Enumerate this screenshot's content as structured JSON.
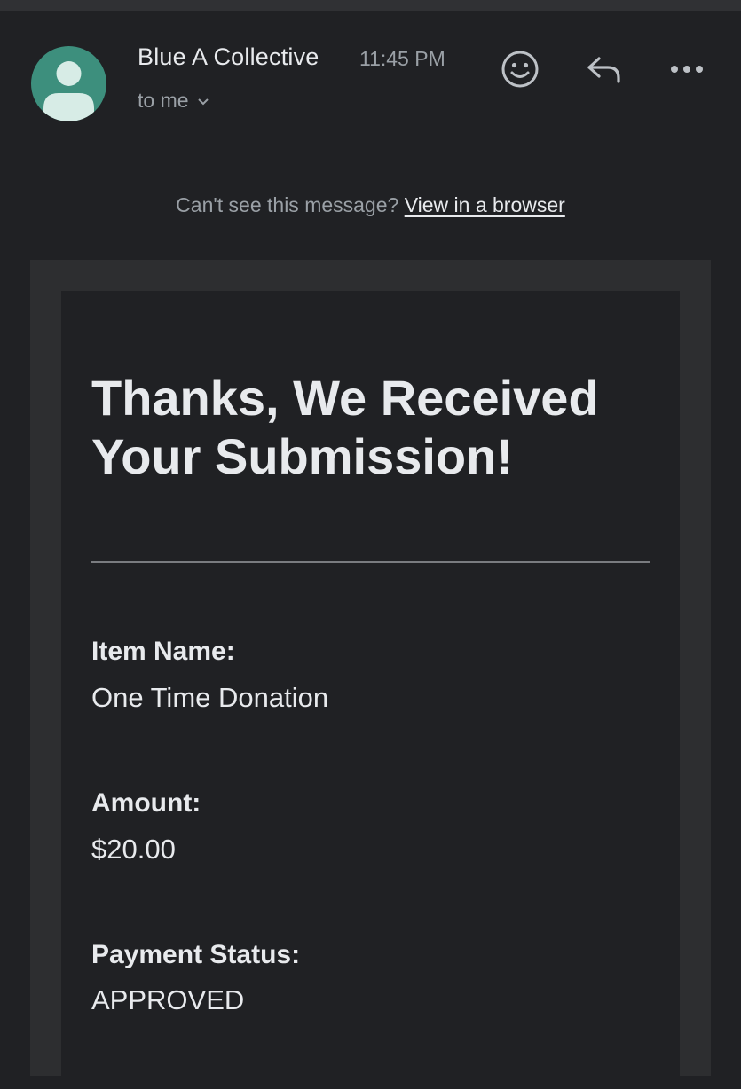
{
  "header": {
    "sender": "Blue A Collective",
    "time": "11:45 PM",
    "recipient": "to me",
    "icons": [
      "avatar-icon",
      "emoji-reaction-icon",
      "reply-icon",
      "more-options-icon",
      "chevron-down-icon"
    ]
  },
  "view_banner": {
    "prompt": "Can't see this message?",
    "link": "View in a browser"
  },
  "message": {
    "headline": "Thanks, We Received Your Submission!",
    "fields": [
      {
        "label": "Item Name:",
        "value": "One Time Donation"
      },
      {
        "label": "Amount:",
        "value": "$20.00"
      },
      {
        "label": "Payment Status:",
        "value": "APPROVED"
      }
    ]
  },
  "colors": {
    "background": "#202124",
    "card_border": "#2d2e30",
    "avatar": "#3d8f7d",
    "text_primary": "#e8eaed",
    "text_secondary": "#9aa0a6"
  }
}
